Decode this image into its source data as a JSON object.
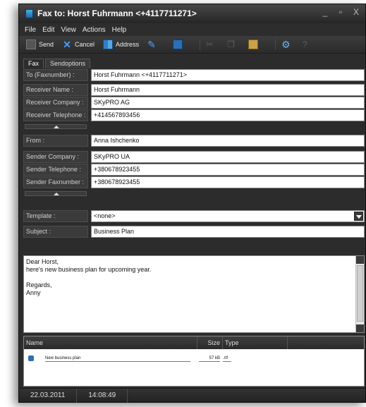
{
  "window": {
    "title": "Fax to: Horst Fuhrmann <+4117711271>",
    "minimize_icon": "_",
    "maximize_icon": "▫",
    "close_icon": "X"
  },
  "menu": [
    "File",
    "Edit",
    "View",
    "Actions",
    "Help"
  ],
  "toolbar": {
    "send_label": "Send",
    "cancel_label": "Cancel",
    "address_label": "Address"
  },
  "tabs": [
    "Fax",
    "Sendoptions"
  ],
  "recipient": {
    "to_label": "To (Faxnumber) :",
    "to_value": "Horst Fuhrmann <+4117711271>",
    "name_label": "Receiver Name :",
    "name_value": "Horst Fuhrmann",
    "company_label": "Receiver Company :",
    "company_value": "SKyPRO AG",
    "telephone_label": "Receiver Telephone :",
    "telephone_value": "+414567893456"
  },
  "sender": {
    "from_label": "From :",
    "from_value": "Anna Ishchenko",
    "company_label": "Sender Company :",
    "company_value": "SKyPRO UA",
    "telephone_label": "Sender Telephone :",
    "telephone_value": "+380678923455",
    "fax_label": "Sender Faxnumber :",
    "fax_value": "+380678923455"
  },
  "document": {
    "template_label": "Template :",
    "template_value": "<none>",
    "subject_label": "Subject :",
    "subject_value": "Business Plan"
  },
  "message": {
    "lines": [
      "Dear Horst,",
      "here's new business plan for upcoming year.",
      "",
      "Regards,",
      "Anny"
    ]
  },
  "attachments": {
    "columns": {
      "name": "Name",
      "size": "Size",
      "type": "Type"
    },
    "files": [
      {
        "name": "New business plan",
        "size": "57 kB",
        "type": ".rtf"
      }
    ]
  },
  "status": {
    "date": "22.03.2011",
    "time": "14:08:49"
  },
  "colors": {
    "window_bg": "#2c2c2c",
    "accent": "#3ea0ff"
  }
}
